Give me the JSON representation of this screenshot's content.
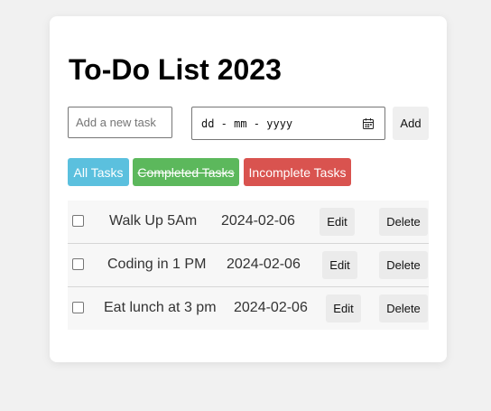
{
  "app": {
    "title": "To-Do List 2023"
  },
  "form": {
    "task_placeholder": "Add a new task",
    "task_value": "",
    "date_placeholder": "dd - mm - yyyy",
    "add_label": "Add"
  },
  "filters": {
    "all_label": "All Tasks",
    "completed_label": "Completed Tasks",
    "incomplete_label": "Incomplete Tasks"
  },
  "tasks": [
    {
      "name": "Walk Up 5Am",
      "date": "2024-02-06",
      "edit_label": "Edit",
      "delete_label": "Delete",
      "completed": false
    },
    {
      "name": "Coding in 1 PM",
      "date": "2024-02-06",
      "edit_label": "Edit",
      "delete_label": "Delete",
      "completed": false
    },
    {
      "name": "Eat lunch at 3 pm",
      "date": "2024-02-06",
      "edit_label": "Edit",
      "delete_label": "Delete",
      "completed": false
    }
  ],
  "colors": {
    "all_tasks": "#5bc0de",
    "completed_tasks": "#5cb85c",
    "incomplete_tasks": "#d9534f"
  },
  "icons": {
    "date_picker": "calendar-icon"
  }
}
